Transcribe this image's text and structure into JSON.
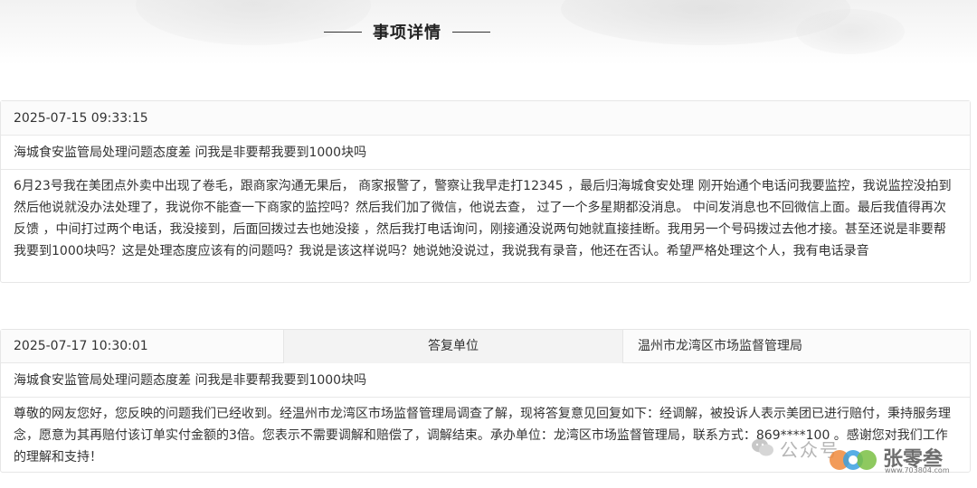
{
  "section": {
    "title": "事项详情"
  },
  "records": [
    {
      "datetime": "2025-07-15 09:33:15",
      "subject": "海城食安监管局处理问题态度差 问我是非要帮我要到1000块吗",
      "body": "6月23号我在美团点外卖中出现了卷毛，跟商家沟通无果后， 商家报警了，警察让我早走打12345 ，最后归海城食安处理 刚开始通个电话问我要监控，我说监控没拍到 然后他说就没办法处理了，我说你不能查一下商家的监控吗？然后我们加了微信，他说去查， 过了一个多星期都没消息。 中间发消息也不回微信上面。最后我值得再次反馈 ，中间打过两个电话，我没接到，后面回拨过去也她没接 ，然后我打电话询问，刚接通没说两句她就直接挂断。我用另一个号码拨过去他才接。甚至还说是非要帮我要到1000块吗？这是处理态度应该有的问题吗？我说是该这样说吗？她说她没说过，我说我有录音，他还在否认。希望严格处理这个人，我有电话录音"
    },
    {
      "datetime": "2025-07-17 10:30:01",
      "reply_unit_label": "答复单位",
      "reply_unit_value": "温州市龙湾区市场监督管理局",
      "subject": "海城食安监管局处理问题态度差 问我是非要帮我要到1000块吗",
      "body": "尊敬的网友您好，您反映的问题我们已经收到。经温州市龙湾区市场监督管理局调查了解，现将答复意见回复如下：经调解，被投诉人表示美团已进行赔付，秉持服务理念，愿意为其再赔付该订单实付金额的3倍。您表示不需要调解和赔偿了，调解结束。承办单位：龙湾区市场监督管理局，联系方式：869****100 。感谢您对我们工作的理解和支持！"
    }
  ],
  "watermark": {
    "text": "公众号",
    "brand": "张零叁",
    "url": "www.703804.com",
    "icon": "wechat-icon"
  }
}
